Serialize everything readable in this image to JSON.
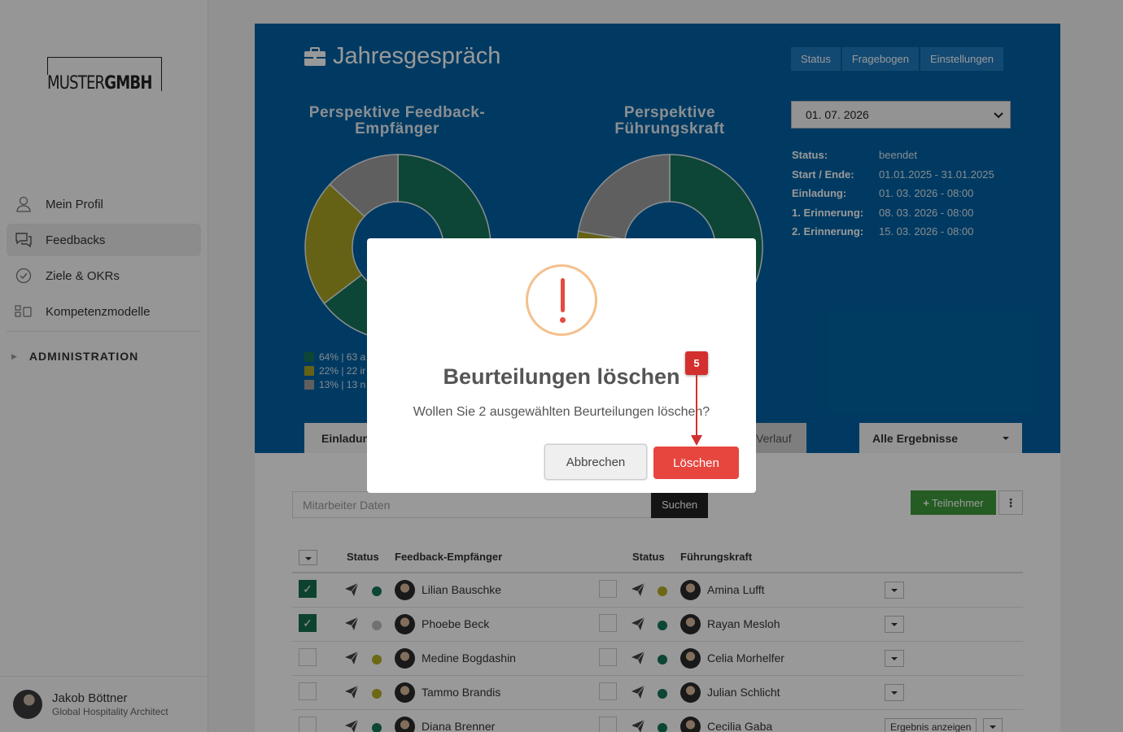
{
  "sidebar": {
    "logo": {
      "light": "MUSTER",
      "bold": "GMBH"
    },
    "items": [
      {
        "label": "Mein Profil",
        "icon": "user-icon"
      },
      {
        "label": "Feedbacks",
        "icon": "chat-icon"
      },
      {
        "label": "Ziele & OKRs",
        "icon": "check-circle-icon"
      },
      {
        "label": "Kompetenzmodelle",
        "icon": "model-icon"
      }
    ],
    "admin_label": "ADMINISTRATION",
    "user": {
      "name": "Jakob Böttner",
      "role": "Global Hospitality Architect"
    }
  },
  "hero": {
    "title": "Jahresgespräch",
    "tabs": [
      "Status",
      "Fragebogen",
      "Einstellungen"
    ],
    "chart_titles": [
      "Perspektive Feedback-Empfänger",
      "Perspektive Führungskraft"
    ],
    "legend": [
      "64% | 63 a",
      "22% | 22 ir",
      "13% | 13 n"
    ],
    "date": "01. 07. 2026",
    "info": [
      {
        "k": "Status:",
        "v": "beendet"
      },
      {
        "k": "Start / Ende:",
        "v": "01.01.2025 - 31.01.2025"
      },
      {
        "k": "Einladung:",
        "v": "01. 03. 2026 - 08:00"
      },
      {
        "k": "1. Erinnerung:",
        "v": "08. 03. 2026 - 08:00"
      },
      {
        "k": "2. Erinnerung:",
        "v": "15. 03. 2026 - 08:00"
      }
    ],
    "subtabs": {
      "left": "Einladung",
      "right": "Verlauf"
    },
    "filter": "Alle Ergebnisse",
    "colors": {
      "green": "#17755a",
      "olive": "#a8a324",
      "grey": "#9e9e9e",
      "blue": "#0062a3"
    }
  },
  "chart_data": [
    {
      "type": "pie",
      "title": "Perspektive Feedback-Empfänger",
      "labels": [
        "green",
        "olive",
        "grey"
      ],
      "values": [
        64,
        22,
        13
      ]
    },
    {
      "type": "pie",
      "title": "Perspektive Führungskraft",
      "labels": [
        "green",
        "olive",
        "grey"
      ],
      "values": [
        64,
        13,
        22
      ]
    }
  ],
  "toolbar": {
    "search_placeholder": "Mitarbeiter Daten",
    "search_btn": "Suchen",
    "add_btn": "Teilnehmer",
    "kebab": "⋮"
  },
  "table": {
    "headers": {
      "status": "Status",
      "recipient": "Feedback-Empfänger",
      "status2": "Status",
      "manager": "Führungskraft"
    },
    "rows": [
      {
        "checked": true,
        "dot1": "#17755a",
        "recipient": "Lilian Bauschke",
        "dot2": "#b5ad22",
        "manager": "Amina Lufft",
        "result": ""
      },
      {
        "checked": true,
        "dot1": "#bdbdbd",
        "recipient": "Phoebe Beck",
        "dot2": "#17755a",
        "manager": "Rayan Mesloh",
        "result": ""
      },
      {
        "checked": false,
        "dot1": "#b5ad22",
        "recipient": "Medine Bogdashin",
        "dot2": "#17755a",
        "manager": "Celia Morhelfer",
        "result": ""
      },
      {
        "checked": false,
        "dot1": "#b5ad22",
        "recipient": "Tammo Brandis",
        "dot2": "#17755a",
        "manager": "Julian Schlicht",
        "result": ""
      },
      {
        "checked": false,
        "dot1": "#17755a",
        "recipient": "Diana Brenner",
        "dot2": "#17755a",
        "manager": "Cecilia Gaba",
        "result": "Ergebnis anzeigen"
      }
    ]
  },
  "modal": {
    "title": "Beurteilungen löschen",
    "text": "Wollen Sie 2 ausgewählten Beurteilungen löschen?",
    "cancel": "Abbrechen",
    "confirm": "Löschen"
  },
  "annotation": {
    "step": "5"
  }
}
